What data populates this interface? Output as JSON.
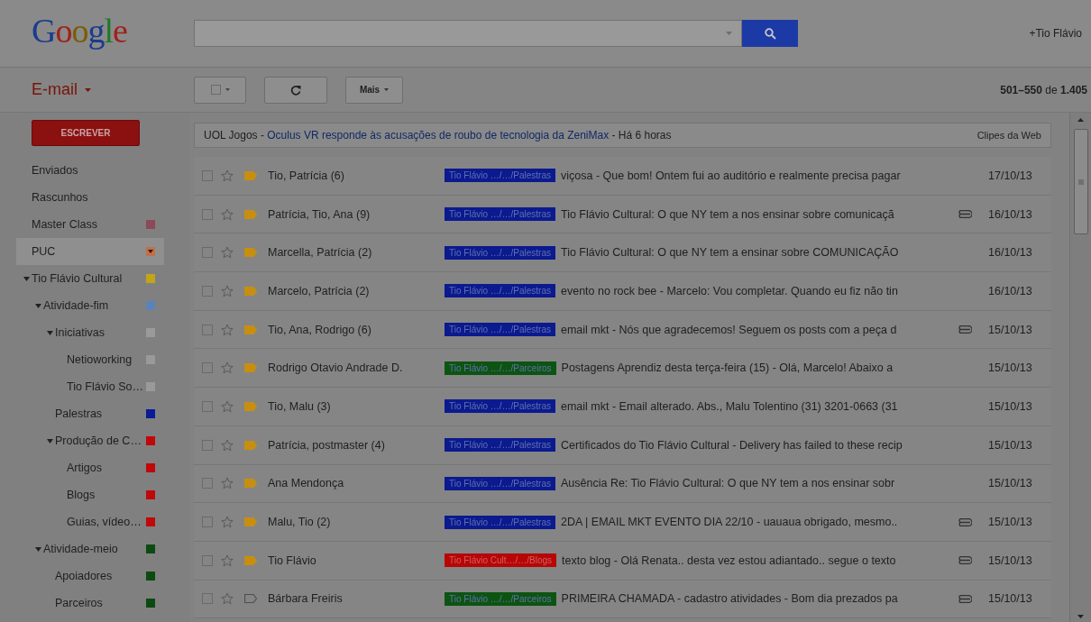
{
  "header": {
    "logo": "Google",
    "account": "+Tio Flávio"
  },
  "toolbar": {
    "app_menu": "E-mail",
    "buttons": [
      {
        "kind": "select"
      },
      {
        "kind": "refresh"
      },
      {
        "kind": "menu",
        "label": "Mais"
      }
    ],
    "pagination": "**501–550** de **1.405**"
  },
  "sidebar": {
    "compose": "ESCREVER",
    "items": [
      {
        "label": "Enviados",
        "selected": false
      },
      {
        "label": "Rascunhos",
        "selected": false
      },
      {
        "label": "Master Class",
        "color": "#8a4a58",
        "selected": false
      },
      {
        "label": "PUC",
        "color": "#c0704a",
        "selected": true
      },
      {
        "label": "Tio Flávio Cultural",
        "color": "#c4a418",
        "selected": false,
        "expanded": true,
        "children": [
          {
            "label": "Atividade-fim",
            "color": "#5a84b8",
            "selected": false,
            "expanded": true,
            "children": [
              {
                "label": "Iniciativas",
                "color": "#9a9a9a",
                "selected": false,
                "expanded": true,
                "children": [
                  {
                    "label": "Netioworking",
                    "color": "#9a9a9a",
                    "selected": false
                  },
                  {
                    "label": "Tio Flávio So…",
                    "color": "#9a9a9a",
                    "selected": false
                  }
                ]
              },
              {
                "label": "Palestras",
                "color": "#0b1a96",
                "selected": false
              },
              {
                "label": "Produção de C…",
                "color": "#c00808",
                "selected": false,
                "expanded": true,
                "children": [
                  {
                    "label": "Artigos",
                    "color": "#c00808",
                    "selected": false
                  },
                  {
                    "label": "Blogs",
                    "color": "#c00808",
                    "selected": false
                  },
                  {
                    "label": "Guias, vídeo…",
                    "color": "#c00808",
                    "selected": false
                  }
                ]
              }
            ]
          },
          {
            "label": "Atividade-meio",
            "color": "#0d4a12",
            "selected": false,
            "expanded": true,
            "children": [
              {
                "label": "Apoiadores",
                "color": "#0d4a12",
                "selected": false
              },
              {
                "label": "Parceiros",
                "color": "#0d4a12",
                "selected": false
              }
            ]
          }
        ]
      }
    ]
  },
  "web_clip": {
    "prefix": "UOL Jogos - ",
    "headline": "Oculus VR responde às acusações de roubo de tecnologia da ZeniMax",
    "suffix": " - Há 6 horas",
    "link": "Clipes da Web"
  },
  "messages": [
    {
      "checked": false,
      "starred": false,
      "important": true,
      "sender": "Tio, Patrícia (6)",
      "label": {
        "text": "Tio Flávio …/…/Palestras",
        "color": "#0b1a8e"
      },
      "subject": "viçosa - Que bom! Ontem fui ao auditório e realmente precisa pagar",
      "attachment": false,
      "date": "17/10/13"
    },
    {
      "checked": false,
      "starred": false,
      "important": true,
      "sender": "Patrícia, Tio, Ana (9)",
      "label": {
        "text": "Tio Flávio …/…/Palestras",
        "color": "#0b1a8e"
      },
      "subject": "Tio Flávio Cultural: O que NY tem a nos ensinar sobre comunicaçã",
      "attachment": true,
      "date": "16/10/13"
    },
    {
      "checked": false,
      "starred": false,
      "important": true,
      "sender": "Marcella, Patrícia (2)",
      "label": {
        "text": "Tio Flávio …/…/Palestras",
        "color": "#0b1a8e"
      },
      "subject": "Tio Flávio Cultural: O que NY tem a ensinar sobre COMUNICAÇÃO",
      "attachment": false,
      "date": "16/10/13"
    },
    {
      "checked": false,
      "starred": false,
      "important": true,
      "sender": "Marcelo, Patrícia (2)",
      "label": {
        "text": "Tio Flávio …/…/Palestras",
        "color": "#0b1a8e"
      },
      "subject": "evento no rock bee - Marcelo: Vou completar. Quando eu fiz não tin",
      "attachment": false,
      "date": "16/10/13"
    },
    {
      "checked": false,
      "starred": false,
      "important": true,
      "sender": "Tio, Ana, Rodrigo (6)",
      "label": {
        "text": "Tio Flávio …/…/Palestras",
        "color": "#0b1a8e"
      },
      "subject": "email mkt - Nós que agradecemos! Seguem os posts com a peça d",
      "attachment": true,
      "date": "15/10/13"
    },
    {
      "checked": false,
      "starred": false,
      "important": true,
      "sender": "Rodrigo Otavio Andrade D.",
      "label": {
        "text": "Tio Flávio …/…/Parceiros",
        "color": "#0d5412"
      },
      "subject": "Postagens Aprendiz desta terça-feira (15) - Olá, Marcelo! Abaixo a",
      "attachment": false,
      "date": "15/10/13"
    },
    {
      "checked": false,
      "starred": false,
      "important": true,
      "sender": "Tio, Malu (3)",
      "label": {
        "text": "Tio Flávio …/…/Palestras",
        "color": "#0b1a8e"
      },
      "subject": "email mkt - Email alterado. Abs., Malu Tolentino (31) 3201-0663 (31",
      "attachment": false,
      "date": "15/10/13"
    },
    {
      "checked": false,
      "starred": false,
      "important": true,
      "sender": "Patrícia, postmaster (4)",
      "label": {
        "text": "Tio Flávio …/…/Palestras",
        "color": "#0b1a8e"
      },
      "subject": "Certificados do Tio Flávio Cultural - Delivery has failed to these recip",
      "attachment": false,
      "date": "15/10/13"
    },
    {
      "checked": false,
      "starred": false,
      "important": true,
      "sender": "Ana Mendonça",
      "label": {
        "text": "Tio Flávio …/…/Palestras",
        "color": "#0b1a8e"
      },
      "subject": "Ausência Re: Tio Flávio Cultural: O que NY tem a nos ensinar sobr",
      "attachment": false,
      "date": "15/10/13"
    },
    {
      "checked": false,
      "starred": false,
      "important": true,
      "sender": "Malu, Tio (2)",
      "label": {
        "text": "Tio Flávio …/…/Palestras",
        "color": "#0b1a8e"
      },
      "subject": "2DA | EMAIL MKT EVENTO DIA 22/10 - uauaua obrigado, mesmo..",
      "attachment": true,
      "date": "15/10/13"
    },
    {
      "checked": false,
      "starred": false,
      "important": true,
      "sender": "Tio Flávio",
      "label": {
        "text": "Tio Flávio Cult…/…/Blogs",
        "color": "#b80606"
      },
      "subject": "texto blog - Olá Renata.. desta vez estou adiantado.. segue o texto",
      "attachment": true,
      "date": "15/10/13"
    },
    {
      "checked": false,
      "starred": false,
      "important": false,
      "sender": "Bárbara Freiris",
      "label": {
        "text": "Tio Flávio …/…/Parceiros",
        "color": "#0d5412"
      },
      "subject": "PRIMEIRA CHAMADA - cadastro atividades - Bom dia prezados pa",
      "attachment": true,
      "date": "15/10/13"
    }
  ]
}
